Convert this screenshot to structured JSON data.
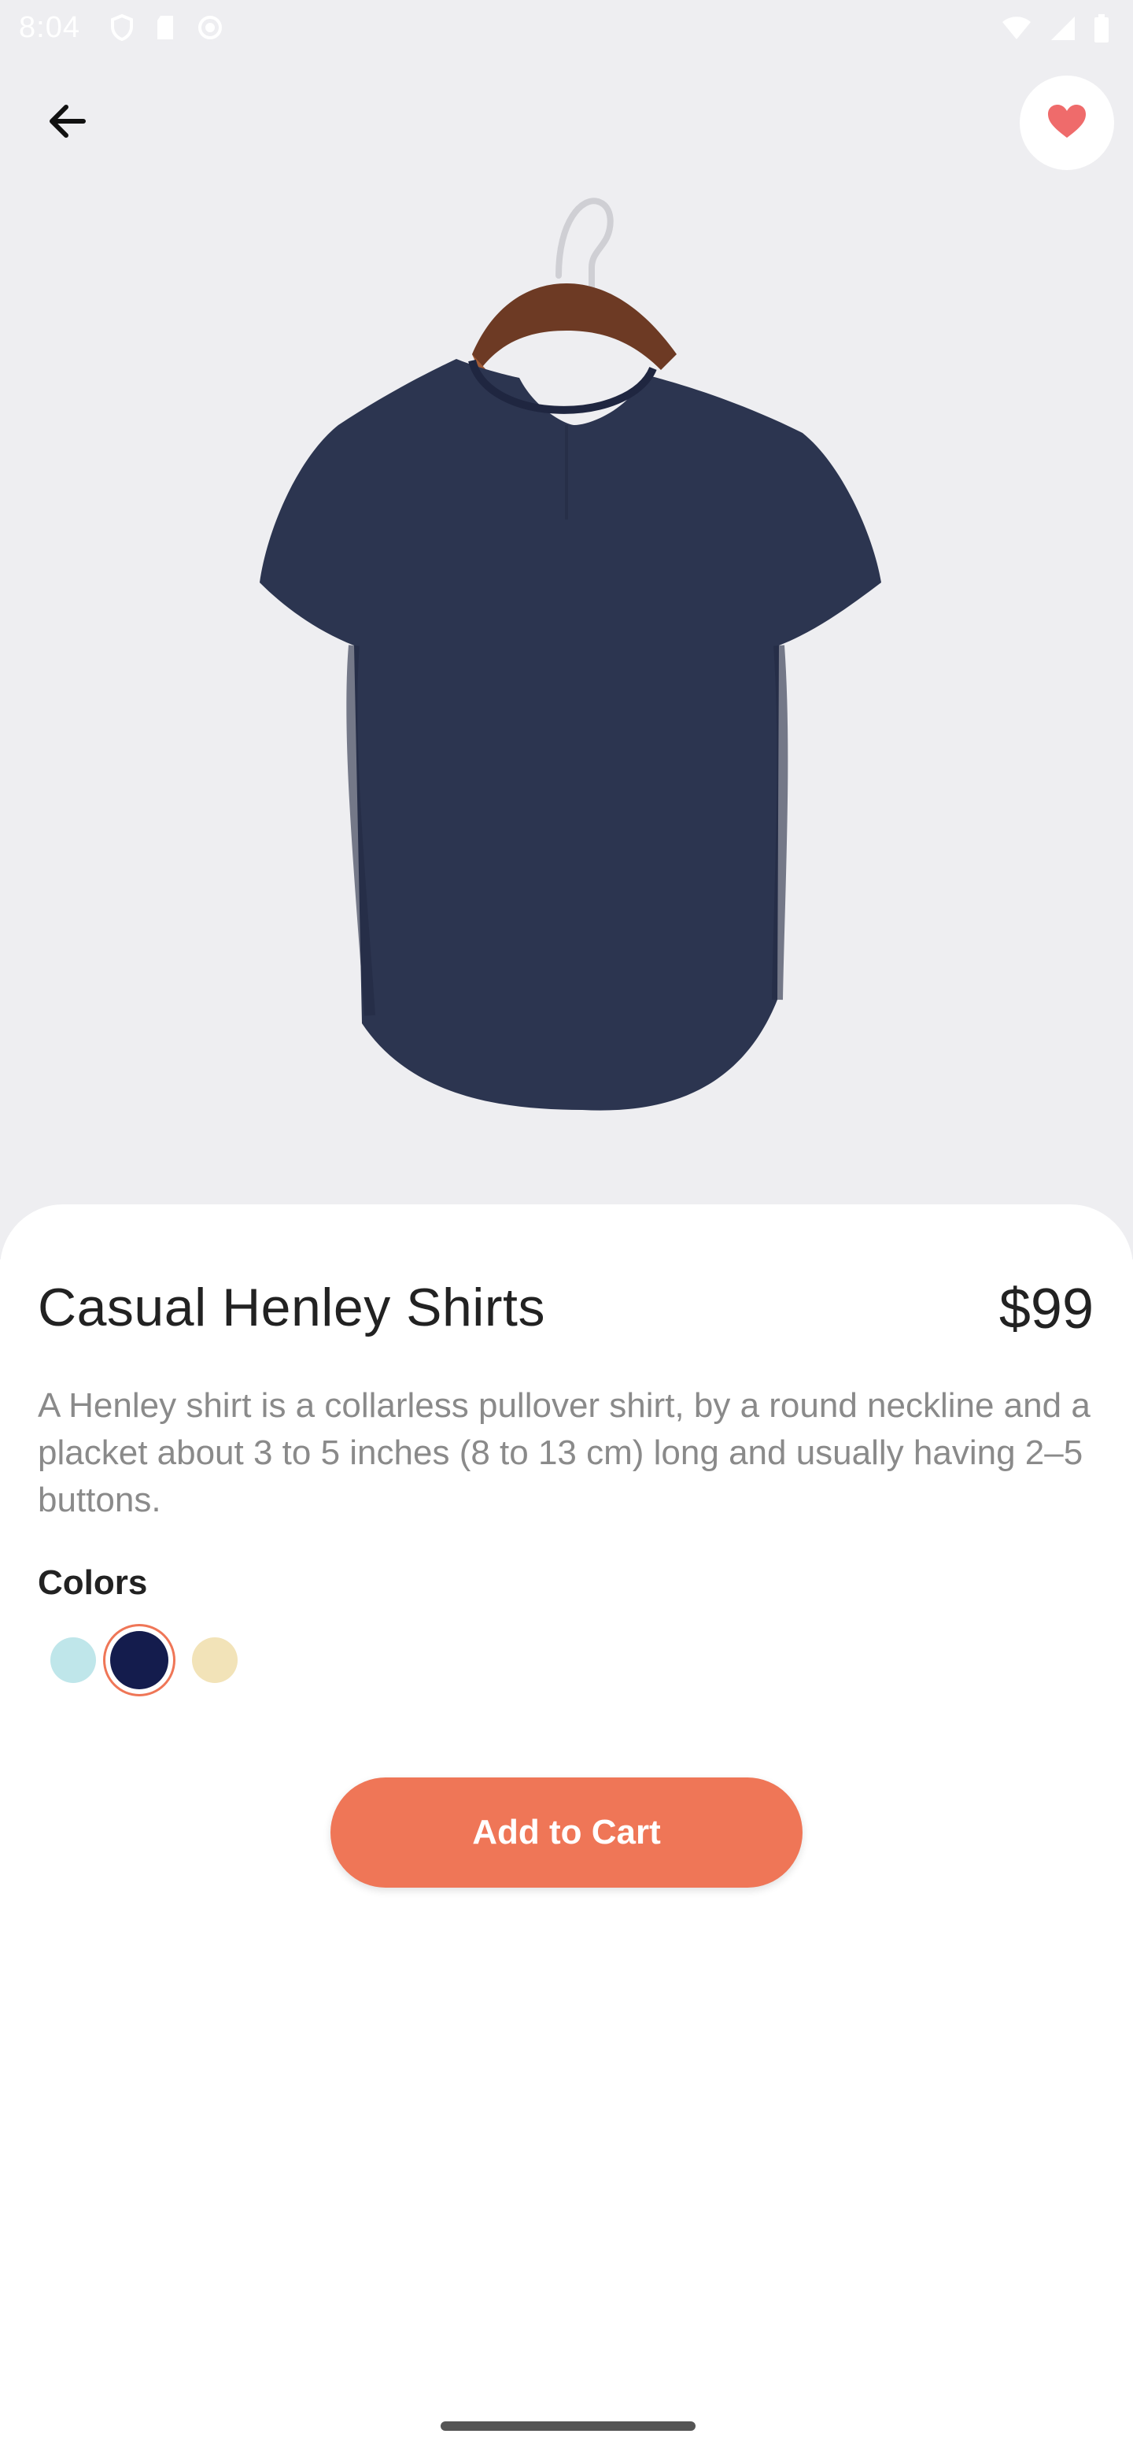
{
  "status_bar": {
    "time": "8:04",
    "left_icons": [
      "shield-icon",
      "sd-card-icon",
      "sync-icon"
    ],
    "right_icons": [
      "wifi-icon",
      "signal-icon",
      "battery-icon"
    ]
  },
  "header": {
    "back_icon": "arrow-left-icon",
    "favorite_icon": "heart-icon",
    "favorite_color": "#ef6b6b"
  },
  "product": {
    "title": "Casual Henley Shirts",
    "price": "$99",
    "description": "A Henley shirt is a collarless pullover shirt, by a round neckline and a placket about 3 to 5 inches (8 to 13 cm) long and usually having 2–5 buttons.",
    "colors_label": "Colors",
    "colors": [
      {
        "color": "#bfe6ea",
        "selected": false
      },
      {
        "color": "#141c4d",
        "selected": true
      },
      {
        "color": "#f2e3b8",
        "selected": false
      }
    ],
    "selected_ring_color": "#ef7657"
  },
  "actions": {
    "add_to_cart_label": "Add to Cart",
    "accent_color": "#ef7657"
  }
}
